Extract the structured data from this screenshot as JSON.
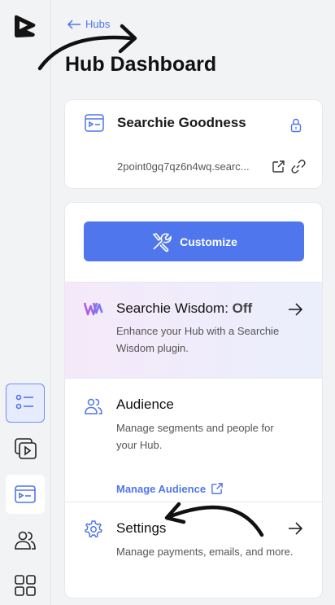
{
  "nav": {
    "back_label": "Hubs",
    "page_title": "Hub Dashboard"
  },
  "hub": {
    "name": "Searchie Goodness",
    "url": "2point0gq7qz6n4wq.searc..."
  },
  "actions": {
    "customize_label": "Customize"
  },
  "wisdom": {
    "title": "Searchie Wisdom:",
    "status": "Off",
    "description": "Enhance your Hub with a Searchie Wisdom plugin."
  },
  "audience": {
    "title": "Audience",
    "description": "Manage segments and people for your Hub.",
    "link_label": "Manage Audience"
  },
  "settings": {
    "title": "Settings",
    "description": "Manage payments, emails, and more."
  },
  "colors": {
    "accent": "#4f76ec",
    "background": "#f1f3f5",
    "card": "#ffffff"
  }
}
